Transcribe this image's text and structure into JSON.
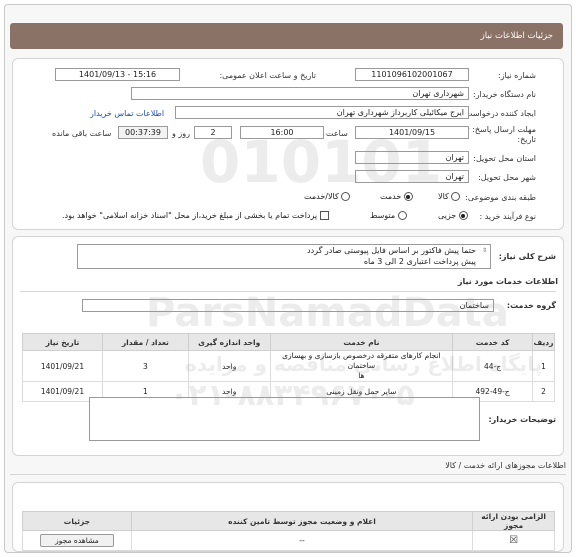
{
  "header": {
    "title": "جزئیات اطلاعات نیاز"
  },
  "fields": {
    "need_number_label": "شماره نیاز:",
    "need_number": "1101096102001067",
    "announce_label": "تاریخ و ساعت اعلان عمومی:",
    "announce_value": "1401/09/13 - 15:16",
    "buyer_org_label": "نام دستگاه خریدار:",
    "buyer_org": "شهرداری تهران",
    "creator_label": "ایجاد کننده درخواست:",
    "creator": "ایرج میکائیلی کاربرداز شهرداری تهران",
    "contact_link": "اطلاعات تماس خریدار",
    "deadline_label_1": "مهلت ارسال پاسخ: تا",
    "deadline_label_2": "تاریخ:",
    "deadline_date": "1401/09/15",
    "time_label": "ساعت",
    "deadline_time": "16:00",
    "days_value": "2",
    "days_label": "روز و",
    "remaining_value": "00:37:39",
    "remaining_label": "ساعت باقی مانده",
    "province_label": "استان محل تحویل:",
    "province": "تهران",
    "city_label": "شهر محل تحویل:",
    "city": "تهران",
    "category_label": "طبقه بندی موضوعی:",
    "category_options": [
      "کالا",
      "خدمت",
      "کالا/خدمت"
    ],
    "category_selected": "خدمت",
    "process_label": "نوع فرآیند خرید :",
    "process_options": [
      "جزیی",
      "متوسط"
    ],
    "process_selected": "جزیی",
    "payment_note": "پرداخت تمام یا بخشی از مبلغ خرید،از محل \"اسناد خزانه اسلامی\" خواهد بود."
  },
  "description": {
    "label": "شرح کلی نیاز:",
    "line1": "حتما پیش فاکتور بر اساس فایل پیوستی صادر گردد",
    "line2": "پیش پرداخت اعتباری 2 الی 3 ماه"
  },
  "services": {
    "section_title": "اطلاعات خدمات مورد نیاز",
    "group_label": "گروه خدمت:",
    "group_value": "ساختمان",
    "columns": [
      "ردیف",
      "کد خدمت",
      "نام خدمت",
      "واحد اندازه گیری",
      "تعداد / مقدار",
      "تاریخ نیاز"
    ],
    "rows": [
      {
        "row": "1",
        "code": "ج-44",
        "name_line1": "انجام کارهای متفرقه درخصوص بازسازی و بهسازی ساختمان",
        "name_line2": "ها",
        "unit": "واحد",
        "qty": "3",
        "date": "1401/09/21"
      },
      {
        "row": "2",
        "code": "ج-49-492",
        "name_line1": "سایر حمل ونقل زمینی",
        "name_line2": "",
        "unit": "واحد",
        "qty": "1",
        "date": "1401/09/21"
      }
    ]
  },
  "buyer_notes": {
    "label": "توضیحات خریدار:"
  },
  "provider": {
    "section_title": "اطلاعات مجوزهای ارائه خدمت / کالا",
    "columns": [
      "الزامی بودن ارائه مجوز",
      "اعلام و وضعیت مجوز توسط تامین کننده",
      "جزئیات"
    ],
    "row": {
      "status": "--",
      "details_button": "مشاهده مجوز"
    }
  },
  "watermark": {
    "digits": "010101",
    "brand": "ParsNamadData",
    "tagline": "پایگاه اطلاع رسانی مناقصه و مزایده",
    "phone": "۰۲۱-۸۸۳۴۹۶۷۰-۵"
  }
}
